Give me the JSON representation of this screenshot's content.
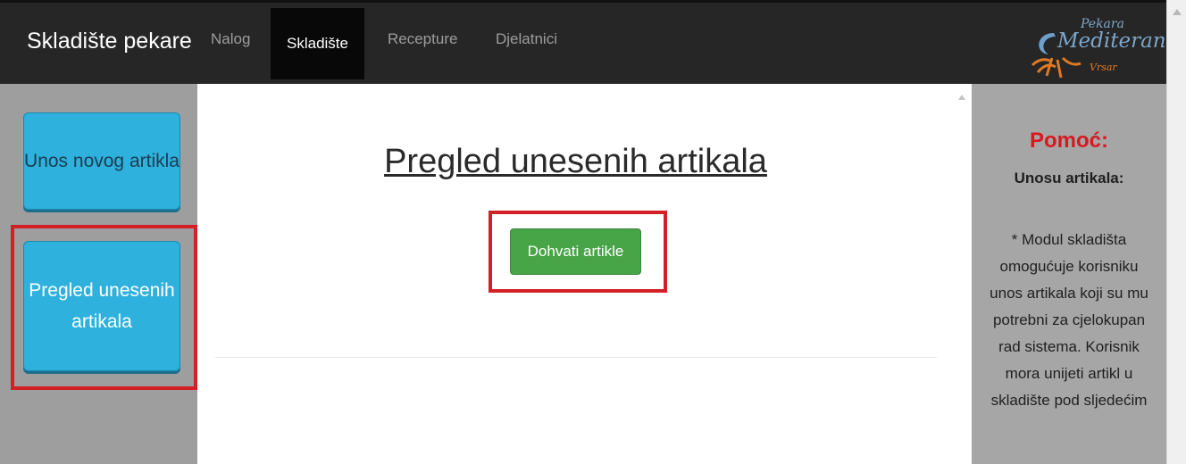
{
  "navbar": {
    "brand": "Skladište pekare",
    "items": [
      {
        "label": "Nalog"
      },
      {
        "label": "Skladište"
      },
      {
        "label": "Recepture"
      },
      {
        "label": "Djelatnici"
      }
    ],
    "logo": {
      "top": "Pekara",
      "main": "Mediteran",
      "sub": "Vrsar"
    }
  },
  "sidebar": {
    "buttons": [
      {
        "label": "Unos novog artikla"
      },
      {
        "label": "Pregled unesenih artikala"
      }
    ]
  },
  "main": {
    "title": "Pregled unesenih artikala",
    "fetch_label": "Dohvati artikle"
  },
  "help": {
    "title": "Pomoć:",
    "subtitle": "Unosu artikala:",
    "text": "* Modul skladišta omogućuje korisniku unos artikala koji su mu potrebni za cjelokupan rad sistema. Korisnik mora unijeti artikl u skladište pod sljedećim"
  },
  "colors": {
    "accent": "#2eb1dc",
    "highlight": "#d32027",
    "success": "#47a447",
    "navbar": "#262626"
  }
}
